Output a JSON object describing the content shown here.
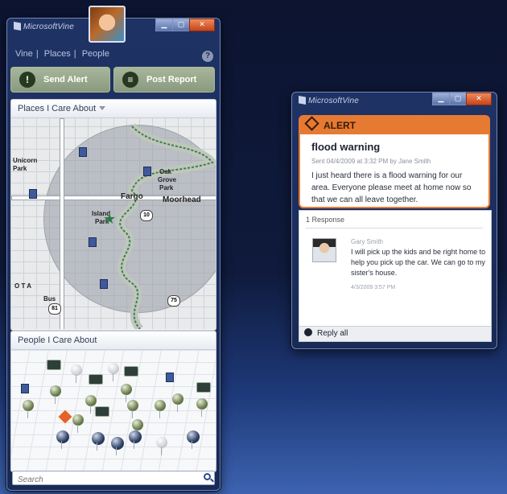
{
  "main_window": {
    "app_logo": "MicrosoftVine",
    "nav": [
      "Vine",
      "Places",
      "People"
    ],
    "send_alert_label": "Send Alert",
    "post_report_label": "Post Report",
    "places_header": "Places I Care About",
    "people_header": "People I Care About",
    "search_placeholder": "Search",
    "map_labels": {
      "city": "Fargo",
      "moorhead": "Moorhead",
      "park1": "Unicorn",
      "park1b": "Park",
      "oak": "Oak",
      "grove": "Grove",
      "park2": "Park",
      "island": "Island",
      "park3": "Park",
      "bus": "Bus",
      "ota": "O T A",
      "hwy10": "10",
      "hwy75": "75",
      "hwy81": "81"
    }
  },
  "alert_window": {
    "app_logo": "MicrosoftVine",
    "badge": "ALERT",
    "title": "flood warning",
    "sent": "Sent 04/4/2009 at 3:32 PM by Jane Smith",
    "message": "I just heard there is a flood warning for our area. Everyone please meet at home now so that we can all leave together.",
    "responses_count": "1 Response",
    "response": {
      "author": "Gary Smith",
      "text": "I will pick up the kids and be right home to help you pick up the car. We can go to my sister's house.",
      "time": "4/3/2009 3:57 PM"
    },
    "reply_all_label": "Reply all"
  },
  "colors": {
    "accent_orange": "#e67a33",
    "button_green": "#8a9a7e",
    "window_blue": "#1f3264"
  }
}
